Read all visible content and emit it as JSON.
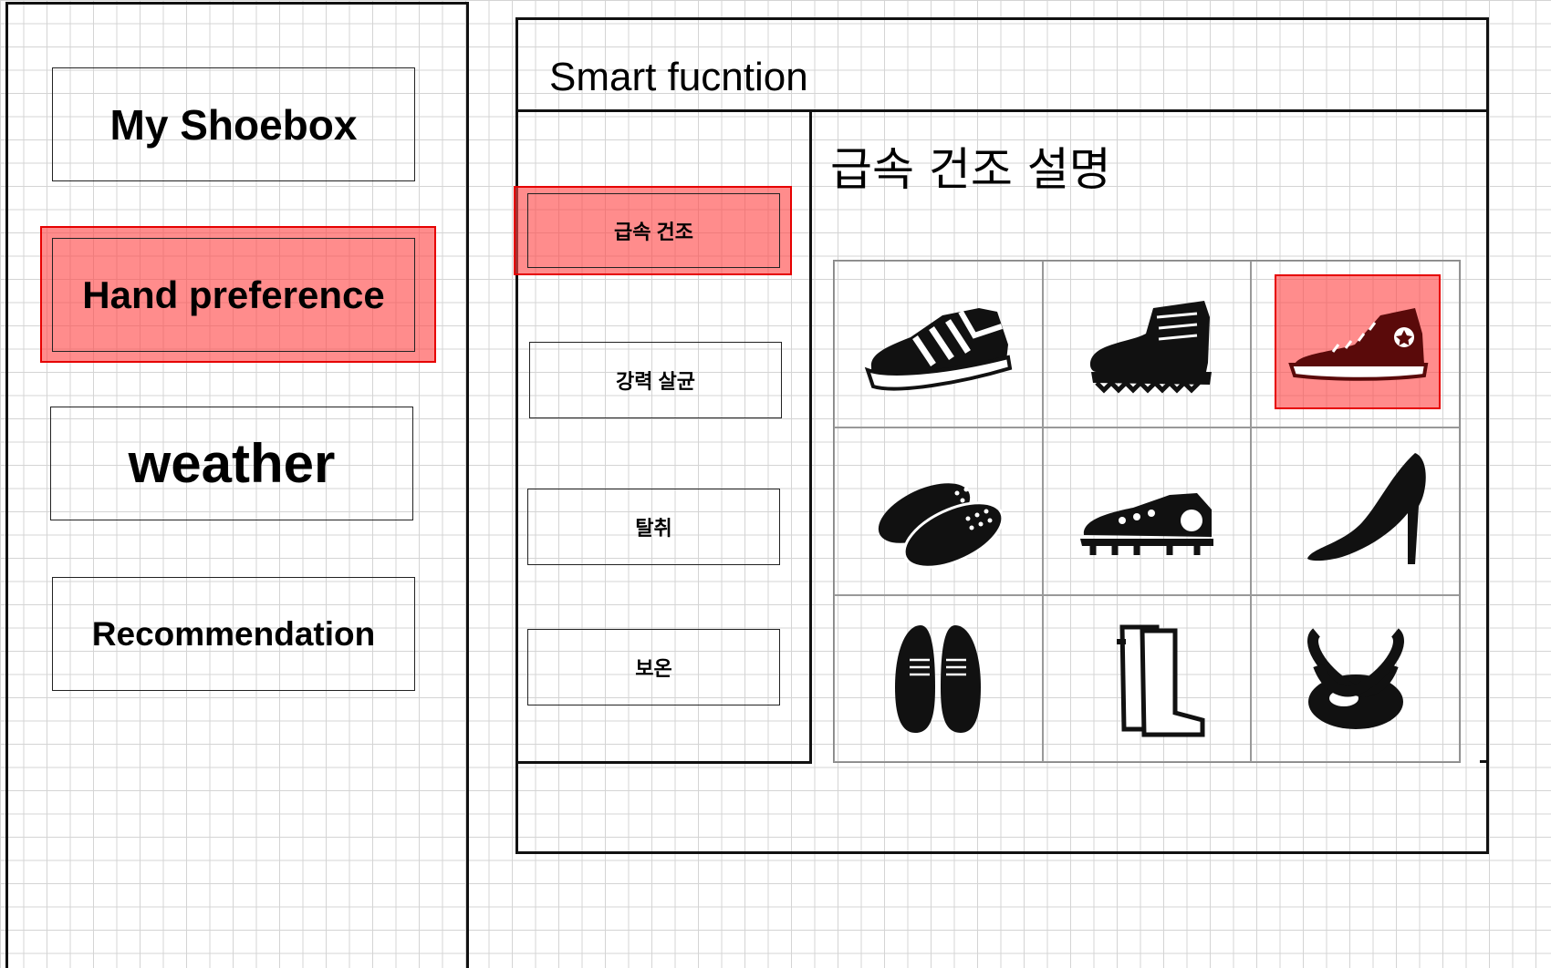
{
  "sidebar": {
    "items": [
      {
        "label": "My Shoebox"
      },
      {
        "label": "Hand preference",
        "highlighted": true
      },
      {
        "label": "weather"
      },
      {
        "label": "Recommendation"
      }
    ]
  },
  "smart": {
    "title": "Smart fucntion",
    "functions": [
      {
        "label": "급속 건조",
        "highlighted": true
      },
      {
        "label": "강력 살균"
      },
      {
        "label": "탈취"
      },
      {
        "label": "보온"
      }
    ],
    "description_title": "급속 건조 설명"
  },
  "shoes": [
    {
      "icon": "sneaker-icon"
    },
    {
      "icon": "work-boot-icon"
    },
    {
      "icon": "high-top-sneaker-icon",
      "selected": true
    },
    {
      "icon": "slippers-icon"
    },
    {
      "icon": "soccer-cleat-icon"
    },
    {
      "icon": "high-heel-icon"
    },
    {
      "icon": "dress-shoes-icon"
    },
    {
      "icon": "rain-boots-icon"
    },
    {
      "icon": "ballet-flats-icon"
    }
  ],
  "colors": {
    "highlight": "#ff4646",
    "highlight_border": "#e60000",
    "grid": "#d4d4d4"
  }
}
